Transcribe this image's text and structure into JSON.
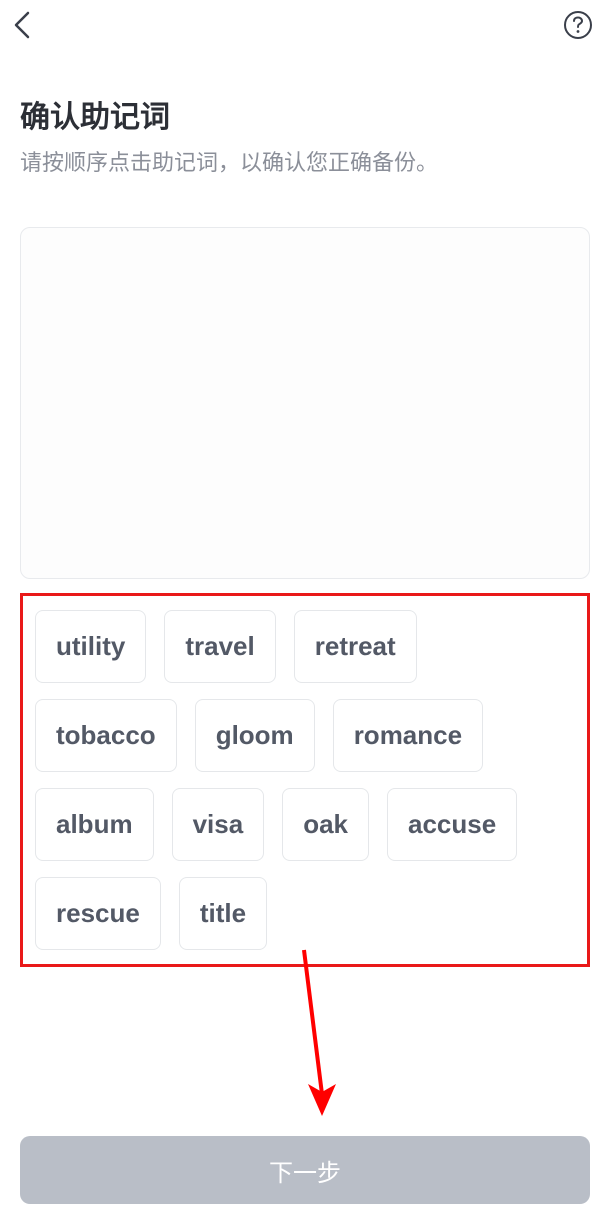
{
  "header": {
    "back_icon": "back-chevron",
    "help_icon": "help-circle"
  },
  "title": "确认助记词",
  "subtitle": "请按顺序点击助记词，以确认您正确备份。",
  "words": [
    "utility",
    "travel",
    "retreat",
    "tobacco",
    "gloom",
    "romance",
    "album",
    "visa",
    "oak",
    "accuse",
    "rescue",
    "title"
  ],
  "next_button_label": "下一步",
  "annotation": {
    "outline_color": "#e91818",
    "arrow_color": "#ff0000"
  }
}
